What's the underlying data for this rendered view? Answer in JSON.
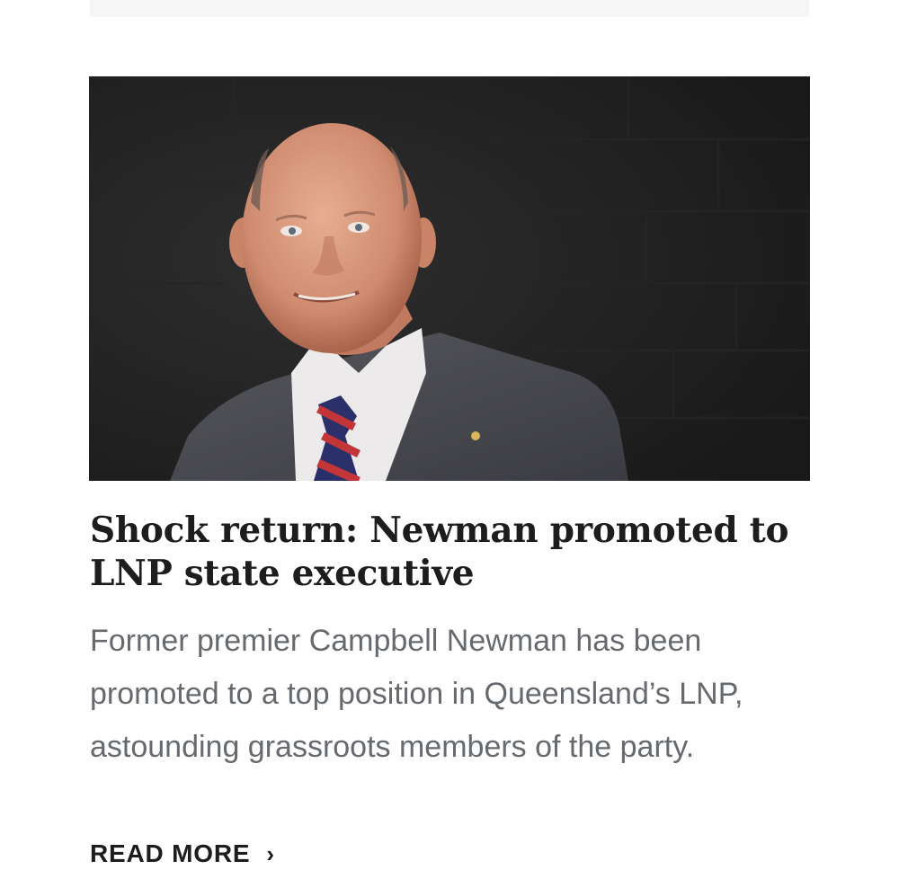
{
  "article": {
    "image_alt": "Campbell Newman",
    "headline": "Shock return: Newman promoted to LNP state executive",
    "summary": "Former premier Campbell Newman has been promoted to a top position in Queensland’s LNP, astounding grassroots members of the party.",
    "read_more_label": "READ MORE",
    "read_more_icon": "chevron-right-icon"
  },
  "colors": {
    "headline": "#1d1d1d",
    "summary": "#666a6e",
    "image_background": "#202020"
  }
}
